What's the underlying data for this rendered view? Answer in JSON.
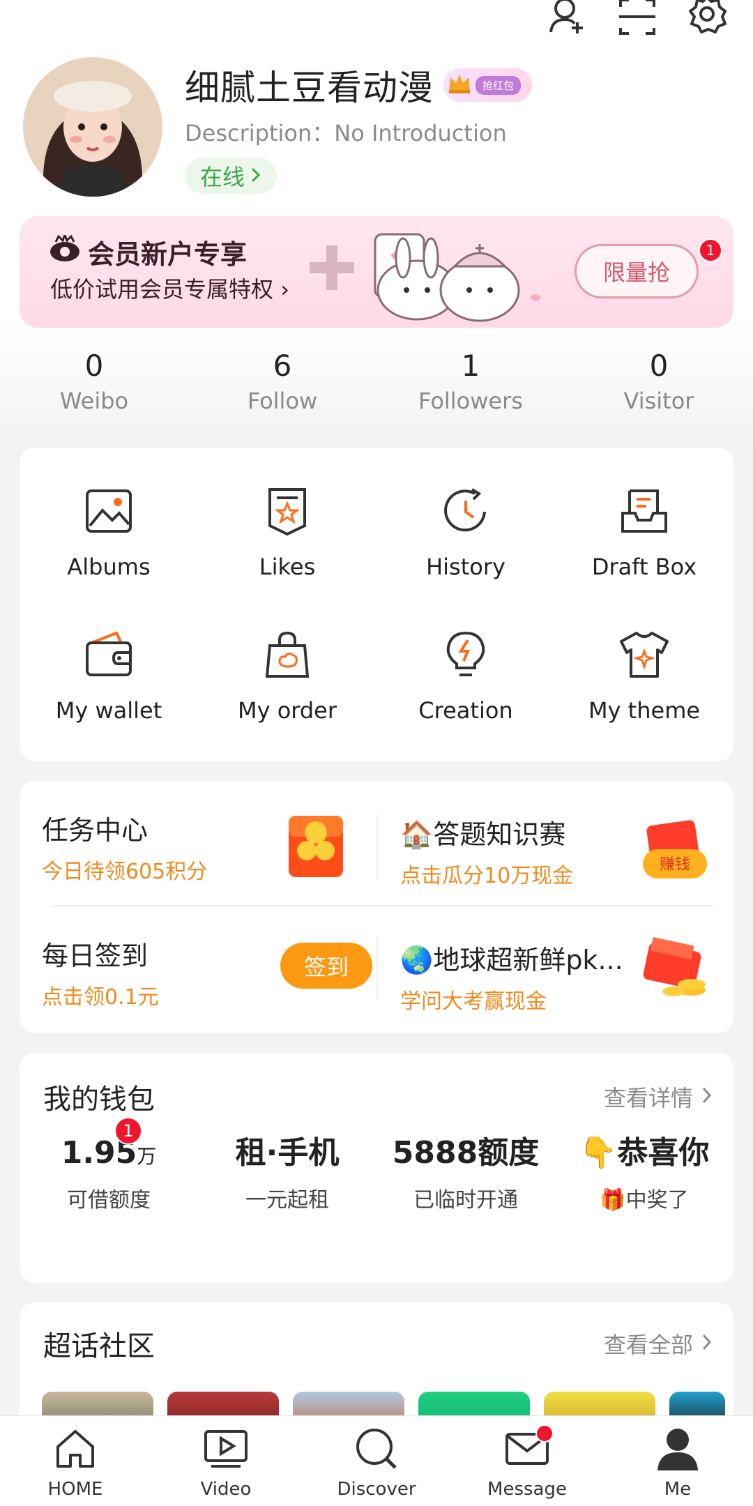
{
  "colors": {
    "accent": "#f08a1e",
    "online_green": "#3aa84a",
    "badge_red": "#f0142c",
    "pink_bg": "#ffe7f0"
  },
  "profile": {
    "username": "细腻土豆看动漫",
    "badge_text": "抢红包",
    "description": "Description：No Introduction",
    "online": "在线"
  },
  "promo": {
    "title": "会员新户专享",
    "subtitle": "低价试用会员专属特权",
    "button": "限量抢",
    "badge": "1"
  },
  "stats": [
    {
      "value": "0",
      "label": "Weibo"
    },
    {
      "value": "6",
      "label": "Follow"
    },
    {
      "value": "1",
      "label": "Followers"
    },
    {
      "value": "0",
      "label": "Visitor"
    }
  ],
  "grid": [
    {
      "label": "Albums",
      "icon": "albums-icon"
    },
    {
      "label": "Likes",
      "icon": "likes-icon"
    },
    {
      "label": "History",
      "icon": "history-icon"
    },
    {
      "label": "Draft Box",
      "icon": "draft-box-icon"
    },
    {
      "label": "My wallet",
      "icon": "wallet-icon"
    },
    {
      "label": "My order",
      "icon": "order-bag-icon"
    },
    {
      "label": "Creation",
      "icon": "lightbulb-icon"
    },
    {
      "label": "My theme",
      "icon": "shirt-icon"
    }
  ],
  "tasks": {
    "task_center": {
      "title": "任务中心",
      "sub": "今日待领605积分"
    },
    "quiz": {
      "title": "🏠答题知识赛",
      "sub": "点击瓜分10万现金",
      "icon_text": "赚钱"
    },
    "checkin": {
      "title": "每日签到",
      "sub": "点击领0.1元",
      "button": "签到"
    },
    "earth": {
      "title": "🌏地球超新鲜pk...",
      "sub": "学问大考赢现金"
    }
  },
  "wallet": {
    "title": "我的钱包",
    "link": "查看详情",
    "items": [
      {
        "big": "1.95",
        "unit": "万",
        "small": "可借额度",
        "badge": "1"
      },
      {
        "big": "租·手机",
        "small": "一元起租"
      },
      {
        "big": "5888额度",
        "small": "已临时开通"
      },
      {
        "big": "👇恭喜你",
        "small": "🎁中奖了"
      }
    ]
  },
  "super_topic": {
    "title": "超话社区",
    "link": "查看全部"
  },
  "tabbar": [
    {
      "label": "HOME",
      "icon": "home-icon"
    },
    {
      "label": "Video",
      "icon": "video-icon"
    },
    {
      "label": "Discover",
      "icon": "discover-search-icon"
    },
    {
      "label": "Message",
      "icon": "message-envelope-icon"
    },
    {
      "label": "Me",
      "icon": "me-person-icon"
    }
  ]
}
